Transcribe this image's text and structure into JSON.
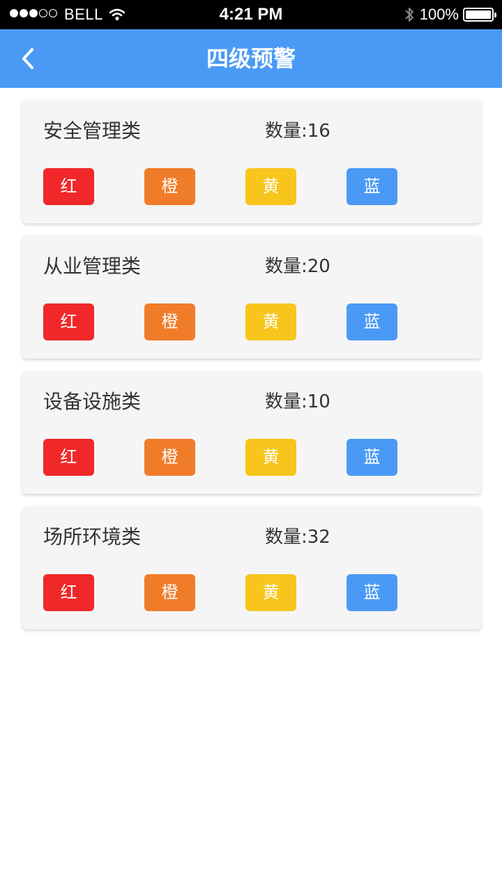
{
  "status_bar": {
    "carrier": "BELL",
    "time": "4:21 PM",
    "battery_percent": "100%",
    "battery_level": 1.0,
    "signal_bars_filled": 3,
    "signal_bars_total": 5
  },
  "nav": {
    "title": "四级预警",
    "back_icon": "chevron-left-icon"
  },
  "levels": [
    {
      "key": "red",
      "label": "红",
      "color": "#f0282a"
    },
    {
      "key": "orange",
      "label": "橙",
      "color": "#f07c2a"
    },
    {
      "key": "yellow",
      "label": "黄",
      "color": "#f7c51b"
    },
    {
      "key": "blue",
      "label": "蓝",
      "color": "#4a9af5"
    }
  ],
  "categories": [
    {
      "title": "安全管理类",
      "count": "数量:16"
    },
    {
      "title": "从业管理类",
      "count": "数量:20"
    },
    {
      "title": "设备设施类",
      "count": "数量:10"
    },
    {
      "title": "场所环境类",
      "count": "数量:32"
    }
  ],
  "colors": {
    "nav_bg": "#4a9af5",
    "card_bg": "#f5f5f5",
    "text": "#333333"
  }
}
